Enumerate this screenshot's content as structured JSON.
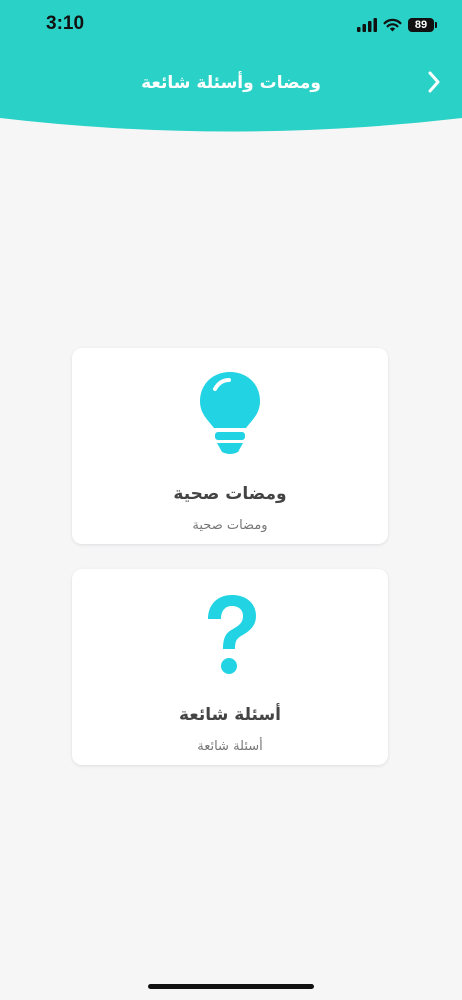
{
  "status_bar": {
    "time": "3:10",
    "battery": "89"
  },
  "header": {
    "title": "ومضات وأسئلة شائعة",
    "accent_color": "#2ad1c6"
  },
  "cards": [
    {
      "title": "ومضات صحية",
      "subtitle": "ومضات صحية",
      "icon": "lightbulb-icon",
      "icon_color": "#22d3e4"
    },
    {
      "title": "أسئلة شائعة",
      "subtitle": "أسئلة شائعة",
      "icon": "question-mark-icon",
      "icon_color": "#22d3e4"
    }
  ]
}
